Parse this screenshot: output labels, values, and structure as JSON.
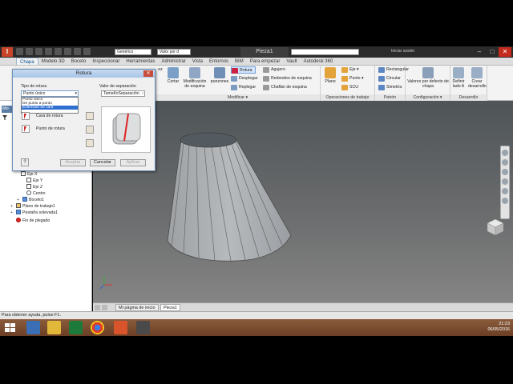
{
  "title_bar": {
    "logo": "I",
    "style_combo": "Genérico",
    "value_combo": "Valor por d",
    "document_title": "Pieza1",
    "login": "Iniciar sesión",
    "minimize": "–",
    "maximize": "□",
    "close": "✕"
  },
  "ribbon_tabs": [
    "Chapa",
    "Modelo 3D",
    "Boceto",
    "Inspeccionar",
    "Herramientas",
    "Administrar",
    "Vista",
    "Entornos",
    "BIM",
    "Para empezar",
    "Vault",
    "Autodesk 360"
  ],
  "ribbon": {
    "cortar": "Cortar",
    "modificacion": "Modificación de esquina",
    "punzones": "punzones",
    "rotura": "Rotura",
    "desplegar": "Desplegar",
    "replegar": "Replegar",
    "agujero": "Agujero",
    "redondeo": "Redondeo de esquina",
    "chaflan": "Chaflán de esquina",
    "modificar_label": "Modificar ▾",
    "plano": "Plano",
    "eje": "Eje ▾",
    "punto": "Punto ▾",
    "scu": "SCU",
    "op_trabajo_label": "Operaciones de trabajo",
    "rectangular": "Rectangular",
    "circular": "Circular",
    "simetria": "Simetría",
    "patron_label": "Patrón",
    "valores": "Valores por defecto de chapa",
    "configuracion_label": "Configuración ▾",
    "definir": "Definir lado A",
    "crear": "Crear desarrollo",
    "desarrollo_label": "Desarrollo",
    "partial_left": "ez"
  },
  "dialog": {
    "title": "Rotura",
    "close": "✕",
    "tipo_label": "Tipo de rotura",
    "tipo_selected": "Punto único",
    "options": [
      "Punto único",
      "De punto a punto",
      "Extensión de cara"
    ],
    "highlighted_option": "Extensión de cara",
    "valor_label": "Valor de separación",
    "valor_value": "TamañoSeparación",
    "cara_label": "Cara de rotura",
    "punto_label": "Punto de rotura",
    "aceptar": "Aceptar",
    "cancelar": "Cancelar",
    "aplicar": "Aplicar"
  },
  "browser": {
    "header_partial": "Mo",
    "items": [
      "Eje Y",
      "Eje Z",
      "Centro",
      "Boceto1",
      "Plano de trabajo1",
      "Pestaña solevada1",
      "Fin de plegado"
    ],
    "partial_item": "Eje X"
  },
  "view_tabs": [
    "Mi página de inicio",
    "Pieza1"
  ],
  "status": "Para obtener ayuda, pulse F1.",
  "clock": {
    "time": "21:23",
    "date": "06/05/2016"
  },
  "colors": {
    "ribbon_accent": "#0b4a8a",
    "highlight": "#2e6fd0",
    "viewport_top": "#4e5457",
    "taskbar": "#6b3f25"
  }
}
